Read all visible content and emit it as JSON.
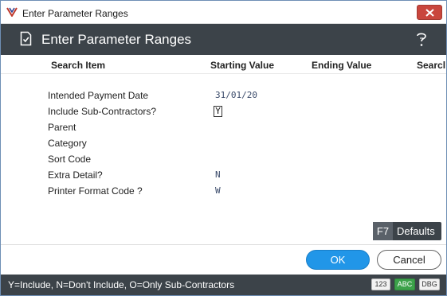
{
  "window": {
    "title": "Enter Parameter Ranges"
  },
  "header": {
    "title": "Enter Parameter Ranges",
    "help_icon": "help-question-icon",
    "doc_icon": "document-check-icon"
  },
  "columns": [
    "Search Item",
    "Starting Value",
    "Ending Value",
    "Searcl"
  ],
  "rows": [
    {
      "label": "Intended Payment Date",
      "start": "31/01/20"
    },
    {
      "label": "Include Sub-Contractors?",
      "start": "Y"
    },
    {
      "label": "Parent",
      "start": ""
    },
    {
      "label": "Category",
      "start": ""
    },
    {
      "label": "Sort Code",
      "start": ""
    },
    {
      "label": "Extra Detail?",
      "start": "N"
    },
    {
      "label": "Printer Format Code ?",
      "start": "W"
    }
  ],
  "defaults_button": {
    "key": "F7",
    "label": "Defaults"
  },
  "buttons": {
    "ok": "OK",
    "cancel": "Cancel"
  },
  "status": {
    "text": "Y=Include, N=Don't Include, O=Only Sub-Contractors",
    "badges": [
      "123",
      "ABC",
      "DBG"
    ]
  },
  "colors": {
    "header_bg": "#3c4349",
    "ok_blue": "#2196e8",
    "close_red": "#c9463d",
    "abc_green": "#3ca24a"
  }
}
